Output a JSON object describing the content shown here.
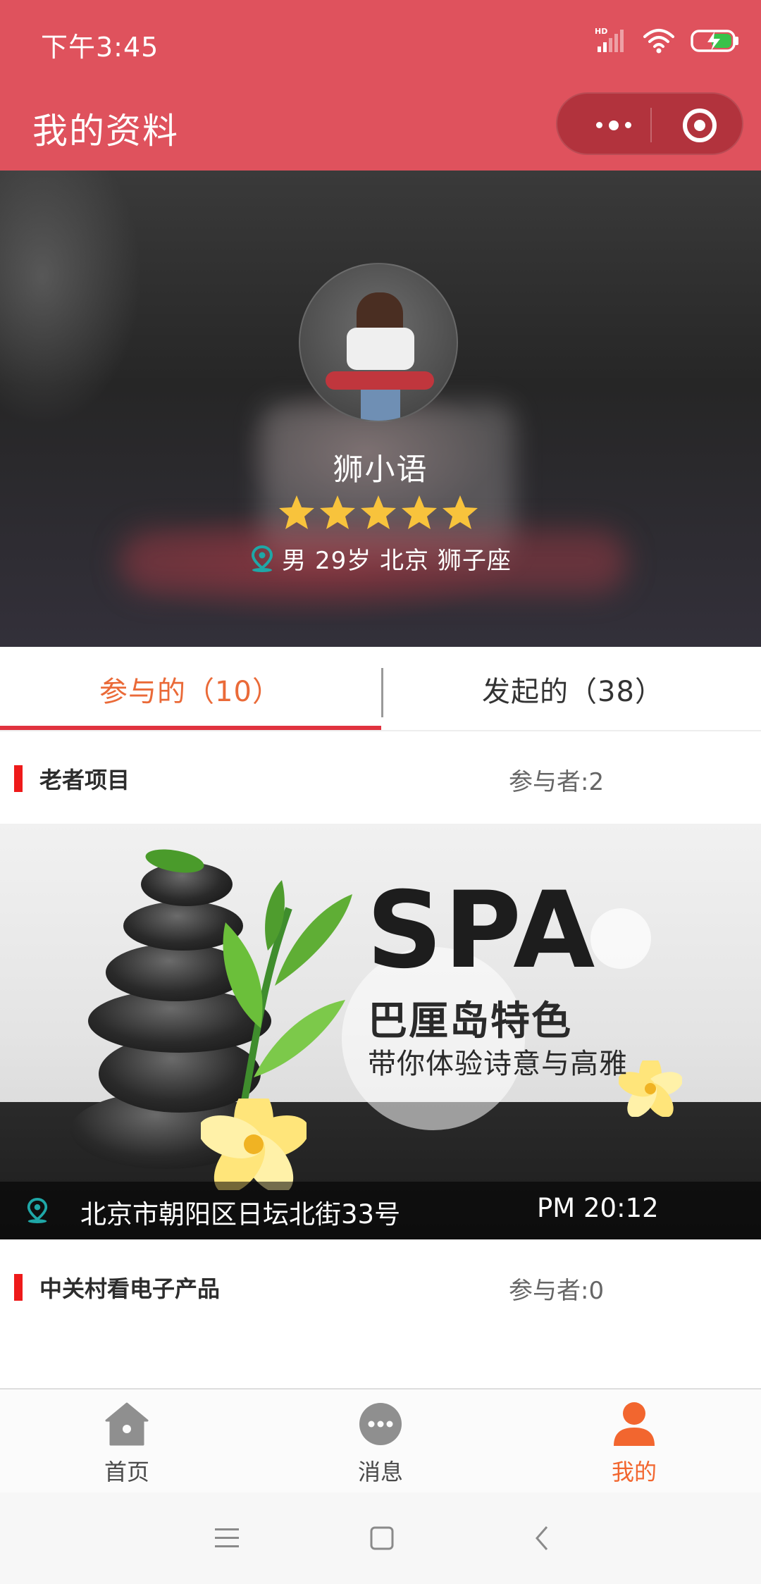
{
  "status_bar": {
    "time": "下午3:45",
    "icons": [
      "hd-signal-icon",
      "wifi-icon",
      "battery-charging-icon"
    ]
  },
  "nav": {
    "title": "我的资料",
    "more_icon": "more-dots-icon",
    "close_icon": "target-close-icon"
  },
  "profile": {
    "name": "狮小语",
    "rating": 5,
    "rating_max": 5,
    "location_icon": "location-pin-icon",
    "info": "男 29岁 北京 狮子座"
  },
  "tabs": [
    {
      "label": "参与的（10）",
      "active": true
    },
    {
      "label": "发起的（38）",
      "active": false
    }
  ],
  "activities": [
    {
      "title": "老者项目",
      "participants": "参与者:2",
      "banner": {
        "headline": "SPA",
        "subtitle": "巴厘岛特色",
        "tagline": "带你体验诗意与高雅"
      },
      "address": "北京市朝阳区日坛北街33号",
      "time": "PM 20:12"
    },
    {
      "title": "中关村看电子产品",
      "participants": "参与者:0"
    }
  ],
  "tabbar": {
    "items": [
      {
        "label": "首页",
        "icon": "home-icon",
        "active": false
      },
      {
        "label": "消息",
        "icon": "message-icon",
        "active": false
      },
      {
        "label": "我的",
        "icon": "user-icon",
        "active": true
      }
    ]
  },
  "colors": {
    "nav_bg": "#df525d",
    "accent": "#ea6a38",
    "tab_underline": "#e0323e",
    "section_marker": "#ee1a1a",
    "star": "#f8c33c",
    "pin": "#1fa7a7",
    "tabbar_active": "#f2662f",
    "tabbar_inactive": "#8f8f8f"
  },
  "system_nav": [
    "menu-icon",
    "home-square-icon",
    "back-icon"
  ]
}
